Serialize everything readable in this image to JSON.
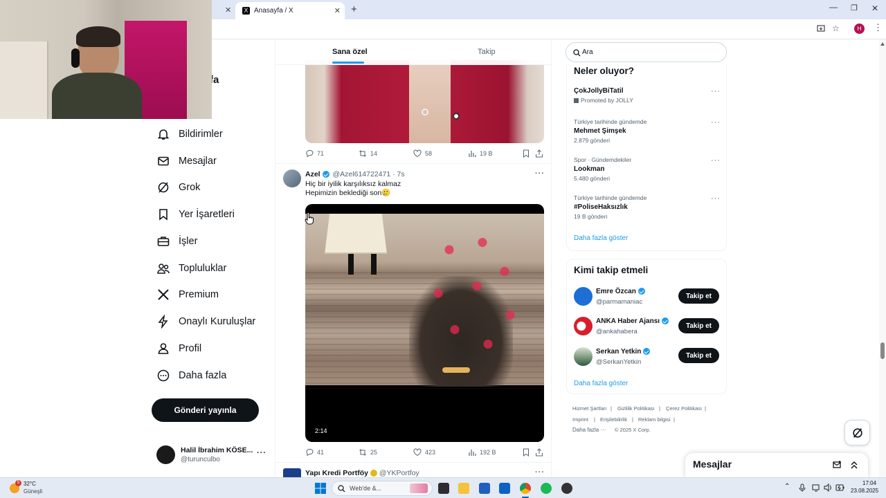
{
  "browser": {
    "active_tab_title": "Anasayfa / X",
    "new_tab_symbol": "+",
    "profile_initial": "H"
  },
  "left_nav": {
    "partial_title": "fa",
    "items": [
      {
        "label": "Bildirimler",
        "icon": "bell-icon"
      },
      {
        "label": "Mesajlar",
        "icon": "mail-icon"
      },
      {
        "label": "Grok",
        "icon": "grok-icon"
      },
      {
        "label": "Yer İşaretleri",
        "icon": "bookmark-icon"
      },
      {
        "label": "İşler",
        "icon": "briefcase-icon"
      },
      {
        "label": "Topluluklar",
        "icon": "communities-icon"
      },
      {
        "label": "Premium",
        "icon": "x-logo-icon"
      },
      {
        "label": "Onaylı Kuruluşlar",
        "icon": "lightning-icon"
      },
      {
        "label": "Profil",
        "icon": "person-icon"
      },
      {
        "label": "Daha fazla",
        "icon": "more-circle-icon"
      }
    ],
    "post_button": "Gönderi yayınla",
    "account": {
      "name": "Halil İbrahim KÖSE...",
      "handle": "@turunculbo"
    }
  },
  "feed": {
    "tabs": [
      {
        "label": "Sana özel",
        "active": true
      },
      {
        "label": "Takip",
        "active": false
      }
    ],
    "post1_stats": {
      "replies": "71",
      "reposts": "14",
      "likes": "58",
      "views": "19 B"
    },
    "post2": {
      "author": "Azel",
      "handle": "@Azel614722471",
      "time": "· 7s",
      "line1": "Hiç bir iyilik karşılıksız kalmaz",
      "line2": "Hepimizin beklediği son🥲",
      "video_duration": "2:14",
      "stats": {
        "replies": "41",
        "reposts": "25",
        "likes": "423",
        "views": "192 B"
      }
    },
    "post3": {
      "author": "Yapı Kredi Portföy",
      "handle": "@YKPortfoy"
    }
  },
  "search": {
    "placeholder": "Ara"
  },
  "trends": {
    "title": "Neler oluyor?",
    "items": [
      {
        "category": "",
        "title": "ÇokJollyBiTatil",
        "meta": "Promoted by JOLLY"
      },
      {
        "category": "Türkiye tarihinde gündemde",
        "title": "Mehmet Şimşek",
        "meta": "2.879 gönderi"
      },
      {
        "category": "Spor · Gündemdekiler",
        "title": "Lookman",
        "meta": "5.480 gönderi"
      },
      {
        "category": "Türkiye tarihinde gündemde",
        "title": "#PoliseHaksızlık",
        "meta": "19 B gönderi"
      }
    ],
    "show_more": "Daha fazla göster"
  },
  "who_to_follow": {
    "title": "Kimi takip etmeli",
    "users": [
      {
        "name": "Emre Özcan",
        "handle": "@parmamaniac",
        "button": "Takip et"
      },
      {
        "name": "ANKA Haber Ajansı",
        "handle": "@ankahabera",
        "button": "Takip et"
      },
      {
        "name": "Serkan Yetkin",
        "handle": "@SerkanYetkin",
        "button": "Takip et"
      }
    ],
    "show_more": "Daha fazla göster"
  },
  "footer": {
    "links": [
      "Hizmet Şartları",
      "Gizlilik Politikası",
      "Çerez Politikası",
      "Imprint",
      "Erişilebilirlik",
      "Reklam bilgisi",
      "Daha fazla ···"
    ],
    "copyright": "© 2025 X Corp."
  },
  "messages_drawer": {
    "title": "Mesajlar"
  },
  "taskbar": {
    "weather_temp": "32°C",
    "weather_desc": "Güneşli",
    "weather_badge": "5",
    "search_placeholder": "Web'de &...",
    "time": "17:04",
    "date": "23.08.2025"
  },
  "colors": {
    "accent": "#1d9bf0",
    "text": "#0f1419",
    "muted": "#536471",
    "taskbar": "#e3eaf3"
  }
}
